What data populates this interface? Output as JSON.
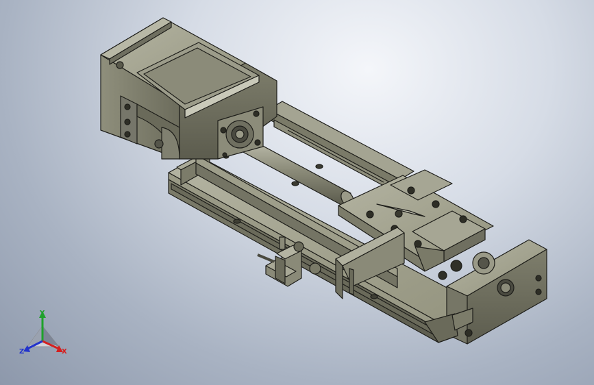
{
  "viewport": {
    "background_top": "#e8ecf2",
    "background_bottom": "#8d98ab"
  },
  "model": {
    "body_color": "#8a8a78",
    "body_light": "#a8a896",
    "body_dark": "#5e5e50",
    "edge_color": "#1e1e1a"
  },
  "triad": {
    "x_label": "X",
    "y_label": "Y",
    "z_label": "Z",
    "x_color": "#d42020",
    "y_color": "#1fa12b",
    "z_color": "#2233cc"
  }
}
